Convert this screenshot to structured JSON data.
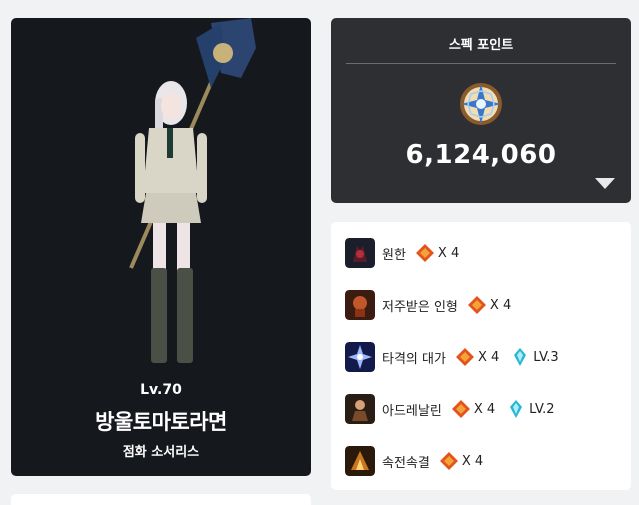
{
  "character": {
    "level": "Lv.70",
    "name": "방울토마토라면",
    "class": "점화 소서리스"
  },
  "spec": {
    "title": "스펙 포인트",
    "value": "6,124,060",
    "icon": "spec-star-emblem",
    "toggle_icon": "triangle-down-icon"
  },
  "engravings": [
    {
      "name": "원한",
      "icon": "engraving-grudge-icon",
      "relic_count": "X 4",
      "ability_stone_level": null
    },
    {
      "name": "저주받은 인형",
      "icon": "engraving-cursed-doll-icon",
      "relic_count": "X 4",
      "ability_stone_level": null
    },
    {
      "name": "타격의 대가",
      "icon": "engraving-hit-master-icon",
      "relic_count": "X 4",
      "ability_stone_level": "LV.3"
    },
    {
      "name": "아드레날린",
      "icon": "engraving-adrenaline-icon",
      "relic_count": "X 4",
      "ability_stone_level": "LV.2"
    },
    {
      "name": "속전속결",
      "icon": "engraving-swift-icon",
      "relic_count": "X 4",
      "ability_stone_level": null
    }
  ],
  "colors": {
    "card_dark": "#15181d",
    "spec_card": "#2d2f33",
    "relic_orange": "#e2541c",
    "stone_cyan": "#27b7d2"
  }
}
